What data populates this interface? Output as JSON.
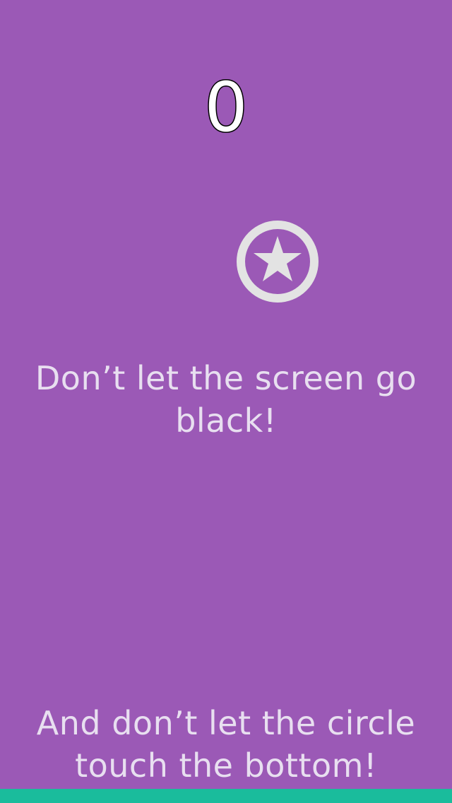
{
  "game": {
    "score": "0",
    "instruction_primary": "Don’t let the screen go black!",
    "instruction_secondary": "And don’t let the circle touch the bottom!",
    "player_icon": "star-circle-icon"
  },
  "colors": {
    "background": "#9b59b6",
    "text": "#e8dff0",
    "player": "#e3e3e3",
    "floor": "#1abc9c"
  }
}
